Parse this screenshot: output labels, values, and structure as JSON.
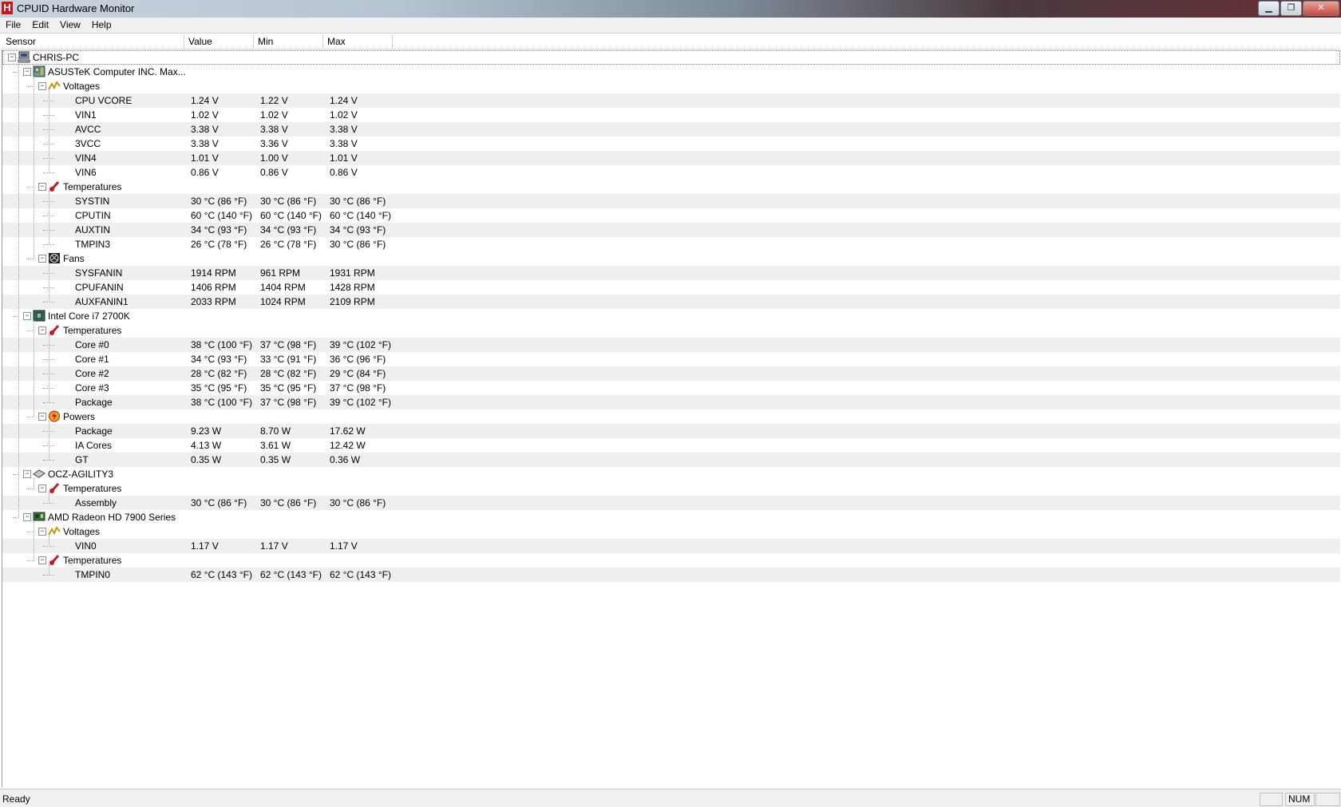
{
  "window": {
    "title": "CPUID Hardware Monitor",
    "icon_letter": "H",
    "buttons": {
      "minimize": "▁",
      "maximize": "❐",
      "close": "✕"
    }
  },
  "menu": [
    "File",
    "Edit",
    "View",
    "Help"
  ],
  "columns": [
    "Sensor",
    "Value",
    "Min",
    "Max"
  ],
  "tree": [
    {
      "level": 0,
      "label": "CHRIS-PC",
      "icon": "computer-icon"
    },
    {
      "level": 1,
      "label": "ASUSTeK Computer INC. Max...",
      "icon": "motherboard-icon"
    },
    {
      "level": 2,
      "label": "Voltages",
      "icon": "voltage-icon"
    },
    {
      "level": 3,
      "label": "CPU VCORE",
      "value": "1.24 V",
      "min": "1.22 V",
      "max": "1.24 V"
    },
    {
      "level": 3,
      "label": "VIN1",
      "value": "1.02 V",
      "min": "1.02 V",
      "max": "1.02 V"
    },
    {
      "level": 3,
      "label": "AVCC",
      "value": "3.38 V",
      "min": "3.38 V",
      "max": "3.38 V"
    },
    {
      "level": 3,
      "label": "3VCC",
      "value": "3.38 V",
      "min": "3.36 V",
      "max": "3.38 V"
    },
    {
      "level": 3,
      "label": "VIN4",
      "value": "1.01 V",
      "min": "1.00 V",
      "max": "1.01 V"
    },
    {
      "level": 3,
      "label": "VIN6",
      "value": "0.86 V",
      "min": "0.86 V",
      "max": "0.86 V"
    },
    {
      "level": 2,
      "label": "Temperatures",
      "icon": "thermometer-icon"
    },
    {
      "level": 3,
      "label": "SYSTIN",
      "value": "30 °C  (86 °F)",
      "min": "30 °C  (86 °F)",
      "max": "30 °C  (86 °F)"
    },
    {
      "level": 3,
      "label": "CPUTIN",
      "value": "60 °C  (140 °F)",
      "min": "60 °C  (140 °F)",
      "max": "60 °C  (140 °F)"
    },
    {
      "level": 3,
      "label": "AUXTIN",
      "value": "34 °C  (93 °F)",
      "min": "34 °C  (93 °F)",
      "max": "34 °C  (93 °F)"
    },
    {
      "level": 3,
      "label": "TMPIN3",
      "value": "26 °C  (78 °F)",
      "min": "26 °C  (78 °F)",
      "max": "30 °C  (86 °F)"
    },
    {
      "level": 2,
      "label": "Fans",
      "icon": "fan-icon"
    },
    {
      "level": 3,
      "label": "SYSFANIN",
      "value": "1914 RPM",
      "min": "961 RPM",
      "max": "1931 RPM"
    },
    {
      "level": 3,
      "label": "CPUFANIN",
      "value": "1406 RPM",
      "min": "1404 RPM",
      "max": "1428 RPM"
    },
    {
      "level": 3,
      "label": "AUXFANIN1",
      "value": "2033 RPM",
      "min": "1024 RPM",
      "max": "2109 RPM"
    },
    {
      "level": 1,
      "label": "Intel Core i7 2700K",
      "icon": "cpu-icon"
    },
    {
      "level": 2,
      "label": "Temperatures",
      "icon": "thermometer-icon"
    },
    {
      "level": 3,
      "label": "Core #0",
      "value": "38 °C  (100 °F)",
      "min": "37 °C  (98 °F)",
      "max": "39 °C  (102 °F)"
    },
    {
      "level": 3,
      "label": "Core #1",
      "value": "34 °C  (93 °F)",
      "min": "33 °C  (91 °F)",
      "max": "36 °C  (96 °F)"
    },
    {
      "level": 3,
      "label": "Core #2",
      "value": "28 °C  (82 °F)",
      "min": "28 °C  (82 °F)",
      "max": "29 °C  (84 °F)"
    },
    {
      "level": 3,
      "label": "Core #3",
      "value": "35 °C  (95 °F)",
      "min": "35 °C  (95 °F)",
      "max": "37 °C  (98 °F)"
    },
    {
      "level": 3,
      "label": "Package",
      "value": "38 °C  (100 °F)",
      "min": "37 °C  (98 °F)",
      "max": "39 °C  (102 °F)"
    },
    {
      "level": 2,
      "label": "Powers",
      "icon": "power-icon"
    },
    {
      "level": 3,
      "label": "Package",
      "value": "9.23 W",
      "min": "8.70 W",
      "max": "17.62 W"
    },
    {
      "level": 3,
      "label": "IA Cores",
      "value": "4.13 W",
      "min": "3.61 W",
      "max": "12.42 W"
    },
    {
      "level": 3,
      "label": "GT",
      "value": "0.35 W",
      "min": "0.35 W",
      "max": "0.36 W"
    },
    {
      "level": 1,
      "label": "OCZ-AGILITY3",
      "icon": "disk-icon"
    },
    {
      "level": 2,
      "label": "Temperatures",
      "icon": "thermometer-icon"
    },
    {
      "level": 3,
      "label": "Assembly",
      "value": "30 °C  (86 °F)",
      "min": "30 °C  (86 °F)",
      "max": "30 °C  (86 °F)"
    },
    {
      "level": 1,
      "label": "AMD Radeon HD 7900 Series",
      "icon": "gpu-icon"
    },
    {
      "level": 2,
      "label": "Voltages",
      "icon": "voltage-icon"
    },
    {
      "level": 3,
      "label": "VIN0",
      "value": "1.17 V",
      "min": "1.17 V",
      "max": "1.17 V"
    },
    {
      "level": 2,
      "label": "Temperatures",
      "icon": "thermometer-icon"
    },
    {
      "level": 3,
      "label": "TMPIN0",
      "value": "62 °C  (143 °F)",
      "min": "62 °C  (143 °F)",
      "max": "62 °C  (143 °F)"
    }
  ],
  "status": {
    "text": "Ready",
    "num": "NUM"
  }
}
